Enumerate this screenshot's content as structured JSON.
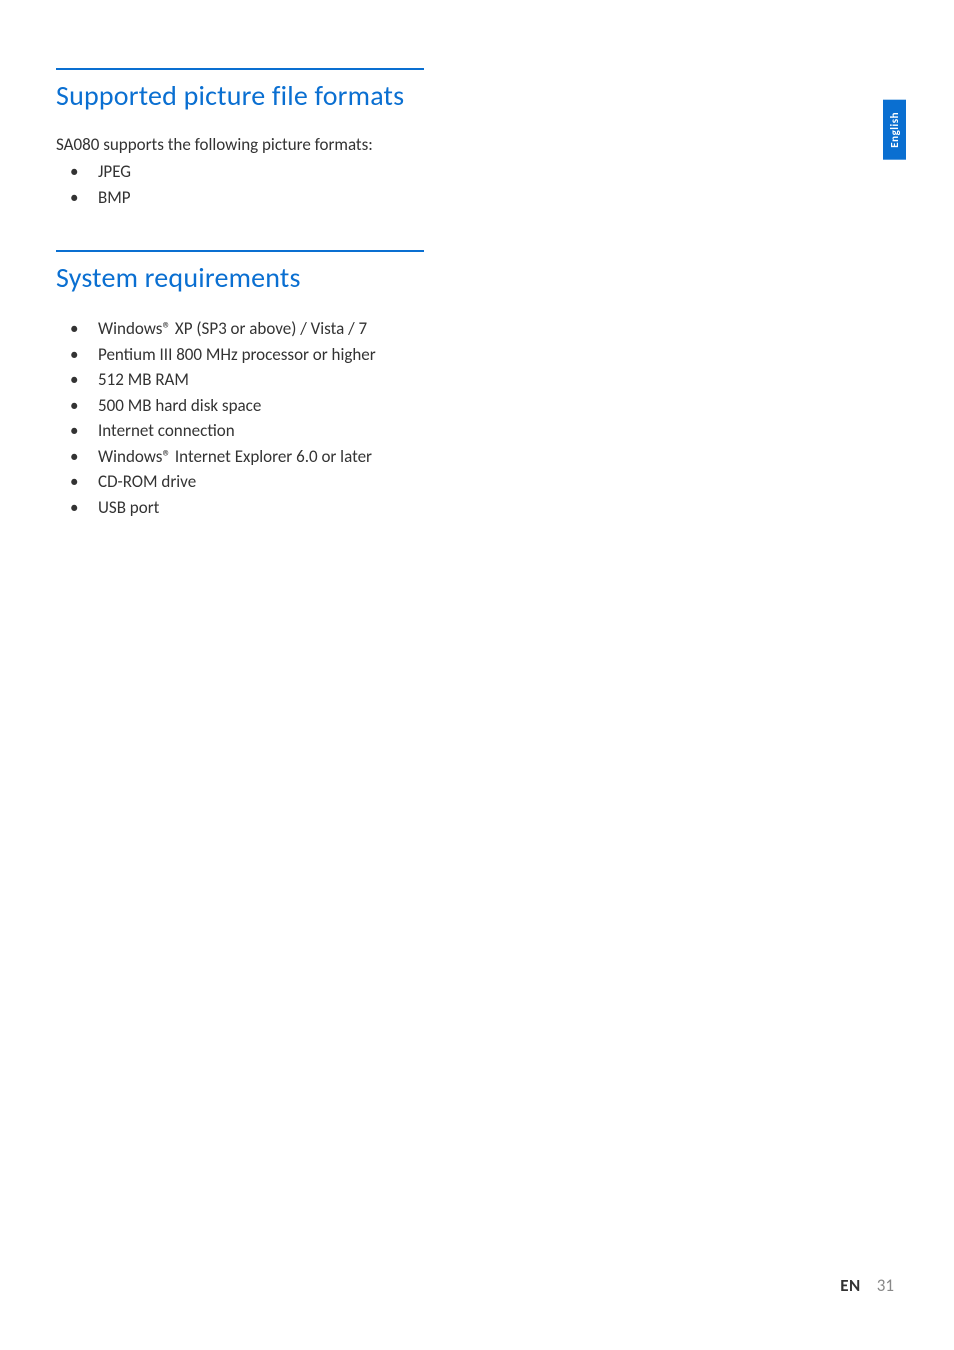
{
  "sideTab": {
    "label": "English"
  },
  "sections": [
    {
      "heading": "Supported picture file formats",
      "intro": "SA080 supports the following picture formats:",
      "items": [
        "JPEG",
        "BMP"
      ]
    },
    {
      "heading": "System requirements",
      "intro": "",
      "items": [
        "Windows® XP (SP3 or above) / Vista / 7",
        "Pentium III 800 MHz processor or higher",
        "512 MB RAM",
        "500 MB hard disk space",
        "Internet connection",
        "Windows® Internet Explorer 6.0 or later",
        "CD-ROM drive",
        "USB port"
      ]
    }
  ],
  "footer": {
    "lang": "EN",
    "page": "31"
  }
}
